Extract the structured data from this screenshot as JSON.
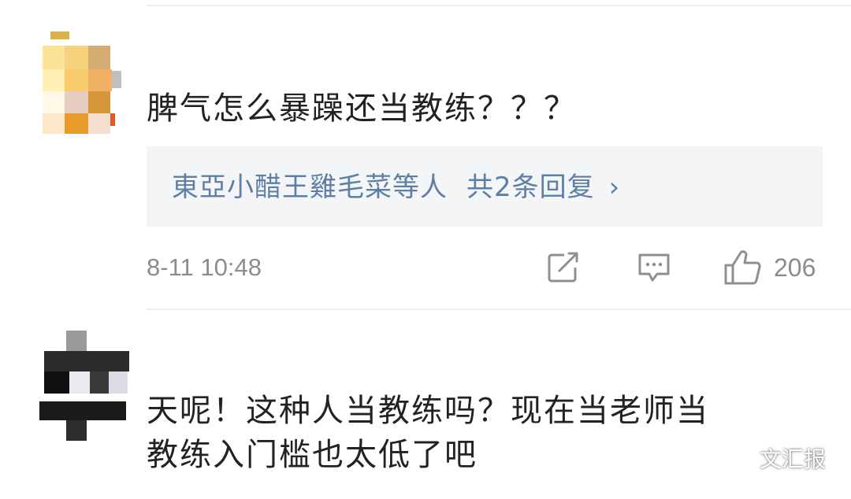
{
  "comments": [
    {
      "username": "",
      "text": "脾气怎么暴躁还当教练？？？",
      "replies": {
        "names": "東亞小醋王雞毛菜等人",
        "count_label": "共2条回复",
        "chevron": "›"
      },
      "time": "8-11 10:48",
      "like_count": "206",
      "icons": [
        "repost-icon",
        "comment-icon",
        "like-icon"
      ]
    },
    {
      "username": "",
      "text": "天呢！这种人当教练吗？现在当老师当\n教练入门槛也太低了吧"
    }
  ],
  "watermark": {
    "label": "文汇报",
    "icon": "wechat-icon"
  },
  "colors": {
    "link_blue": "#5d7fa6",
    "meta_gray": "#8c8c8c",
    "reply_bg": "#f4f5f7"
  }
}
